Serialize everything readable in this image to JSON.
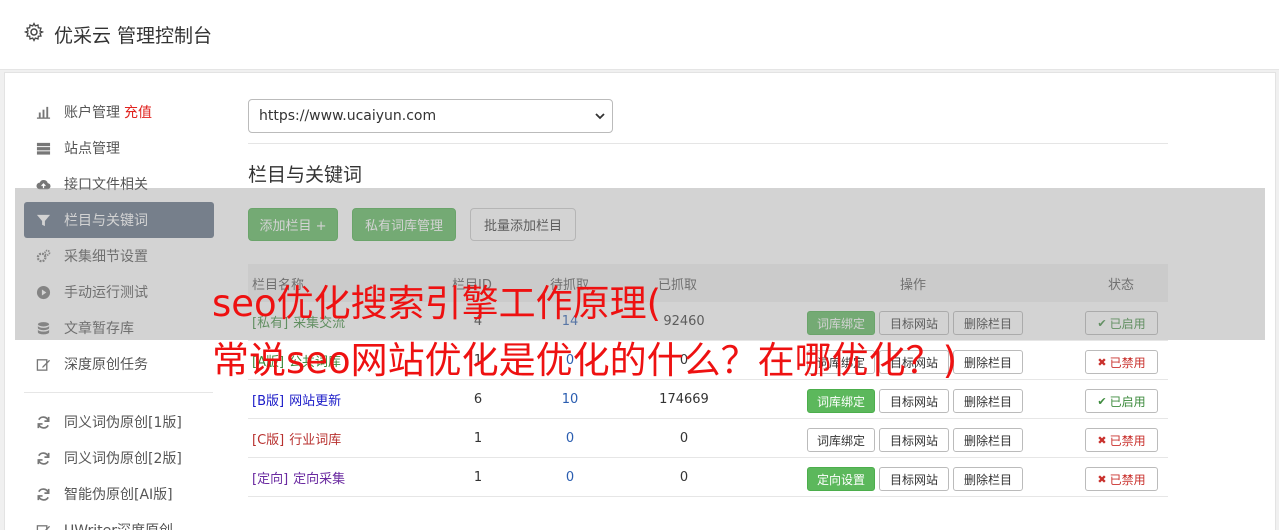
{
  "header": {
    "title": "优采云 管理控制台"
  },
  "menu": {
    "items": [
      {
        "label": "账户管理",
        "extra": "充值",
        "icon": "bar-chart-icon"
      },
      {
        "label": "站点管理",
        "icon": "server-icon"
      },
      {
        "label": "接口文件相关",
        "icon": "cloud-upload-icon"
      },
      {
        "label": "栏目与关键词",
        "icon": "filter-icon",
        "active": true
      },
      {
        "label": "采集细节设置",
        "icon": "cogs-icon"
      },
      {
        "label": "手动运行测试",
        "icon": "play-circle-icon"
      },
      {
        "label": "文章暂存库",
        "icon": "database-icon"
      },
      {
        "label": "深度原创任务",
        "icon": "edit-icon"
      }
    ],
    "items2": [
      {
        "label": "同义词伪原创[1版]",
        "icon": "refresh-icon"
      },
      {
        "label": "同义词伪原创[2版]",
        "icon": "refresh-icon"
      },
      {
        "label": "智能伪原创[AI版]",
        "icon": "refresh-icon"
      },
      {
        "label": "UWriter深度原创",
        "icon": "edit-icon"
      }
    ]
  },
  "site_select": {
    "value": "https://www.ucaiyun.com"
  },
  "section": {
    "title": "栏目与关键词"
  },
  "toolbar": {
    "add_label": "添加栏目 +",
    "private_label": "私有词库管理",
    "batch_label": "批量添加栏目"
  },
  "table": {
    "headers": [
      "栏目名称",
      "栏目ID",
      "待抓取",
      "已抓取",
      "操作",
      "状态"
    ],
    "rows": [
      {
        "tag": "[私有]",
        "name": "采集交流",
        "n1": "4",
        "n2": "14",
        "n3": "92460",
        "btn1": "词库绑定",
        "btn1_green": true,
        "btn2": "目标网站",
        "btn3": "删除栏目",
        "status": "已启用",
        "on": true,
        "tag_class": "t-priv"
      },
      {
        "tag": "[A版]",
        "name": "公共词库",
        "n1": "1",
        "n2": "0",
        "n3": "0",
        "btn1": "词库绑定",
        "btn1_green": false,
        "btn2": "目标网站",
        "btn3": "删除栏目",
        "status": "已禁用",
        "on": false,
        "tag_class": "t-a"
      },
      {
        "tag": "[B版]",
        "name": "网站更新",
        "n1": "6",
        "n2": "10",
        "n3": "174669",
        "btn1": "词库绑定",
        "btn1_green": true,
        "btn2": "目标网站",
        "btn3": "删除栏目",
        "status": "已启用",
        "on": true,
        "tag_class": "t-b"
      },
      {
        "tag": "[C版]",
        "name": "行业词库",
        "n1": "1",
        "n2": "0",
        "n3": "0",
        "btn1": "词库绑定",
        "btn1_green": false,
        "btn2": "目标网站",
        "btn3": "删除栏目",
        "status": "已禁用",
        "on": false,
        "tag_class": "t-c"
      },
      {
        "tag": "[定向]",
        "name": "定向采集",
        "n1": "1",
        "n2": "0",
        "n3": "0",
        "btn1": "定向设置",
        "btn1_green": true,
        "btn2": "目标网站",
        "btn3": "删除栏目",
        "status": "已禁用",
        "on": false,
        "tag_class": "t-d"
      }
    ]
  },
  "overlay_text": {
    "line1": "seo优化搜索引擎工作原理(",
    "line2": "常说seo网站优化是优化的什么？在哪优化？)"
  },
  "colors": {
    "active_menu": "#5f6f84",
    "green": "#5cb85c",
    "red": "#ee1111"
  }
}
